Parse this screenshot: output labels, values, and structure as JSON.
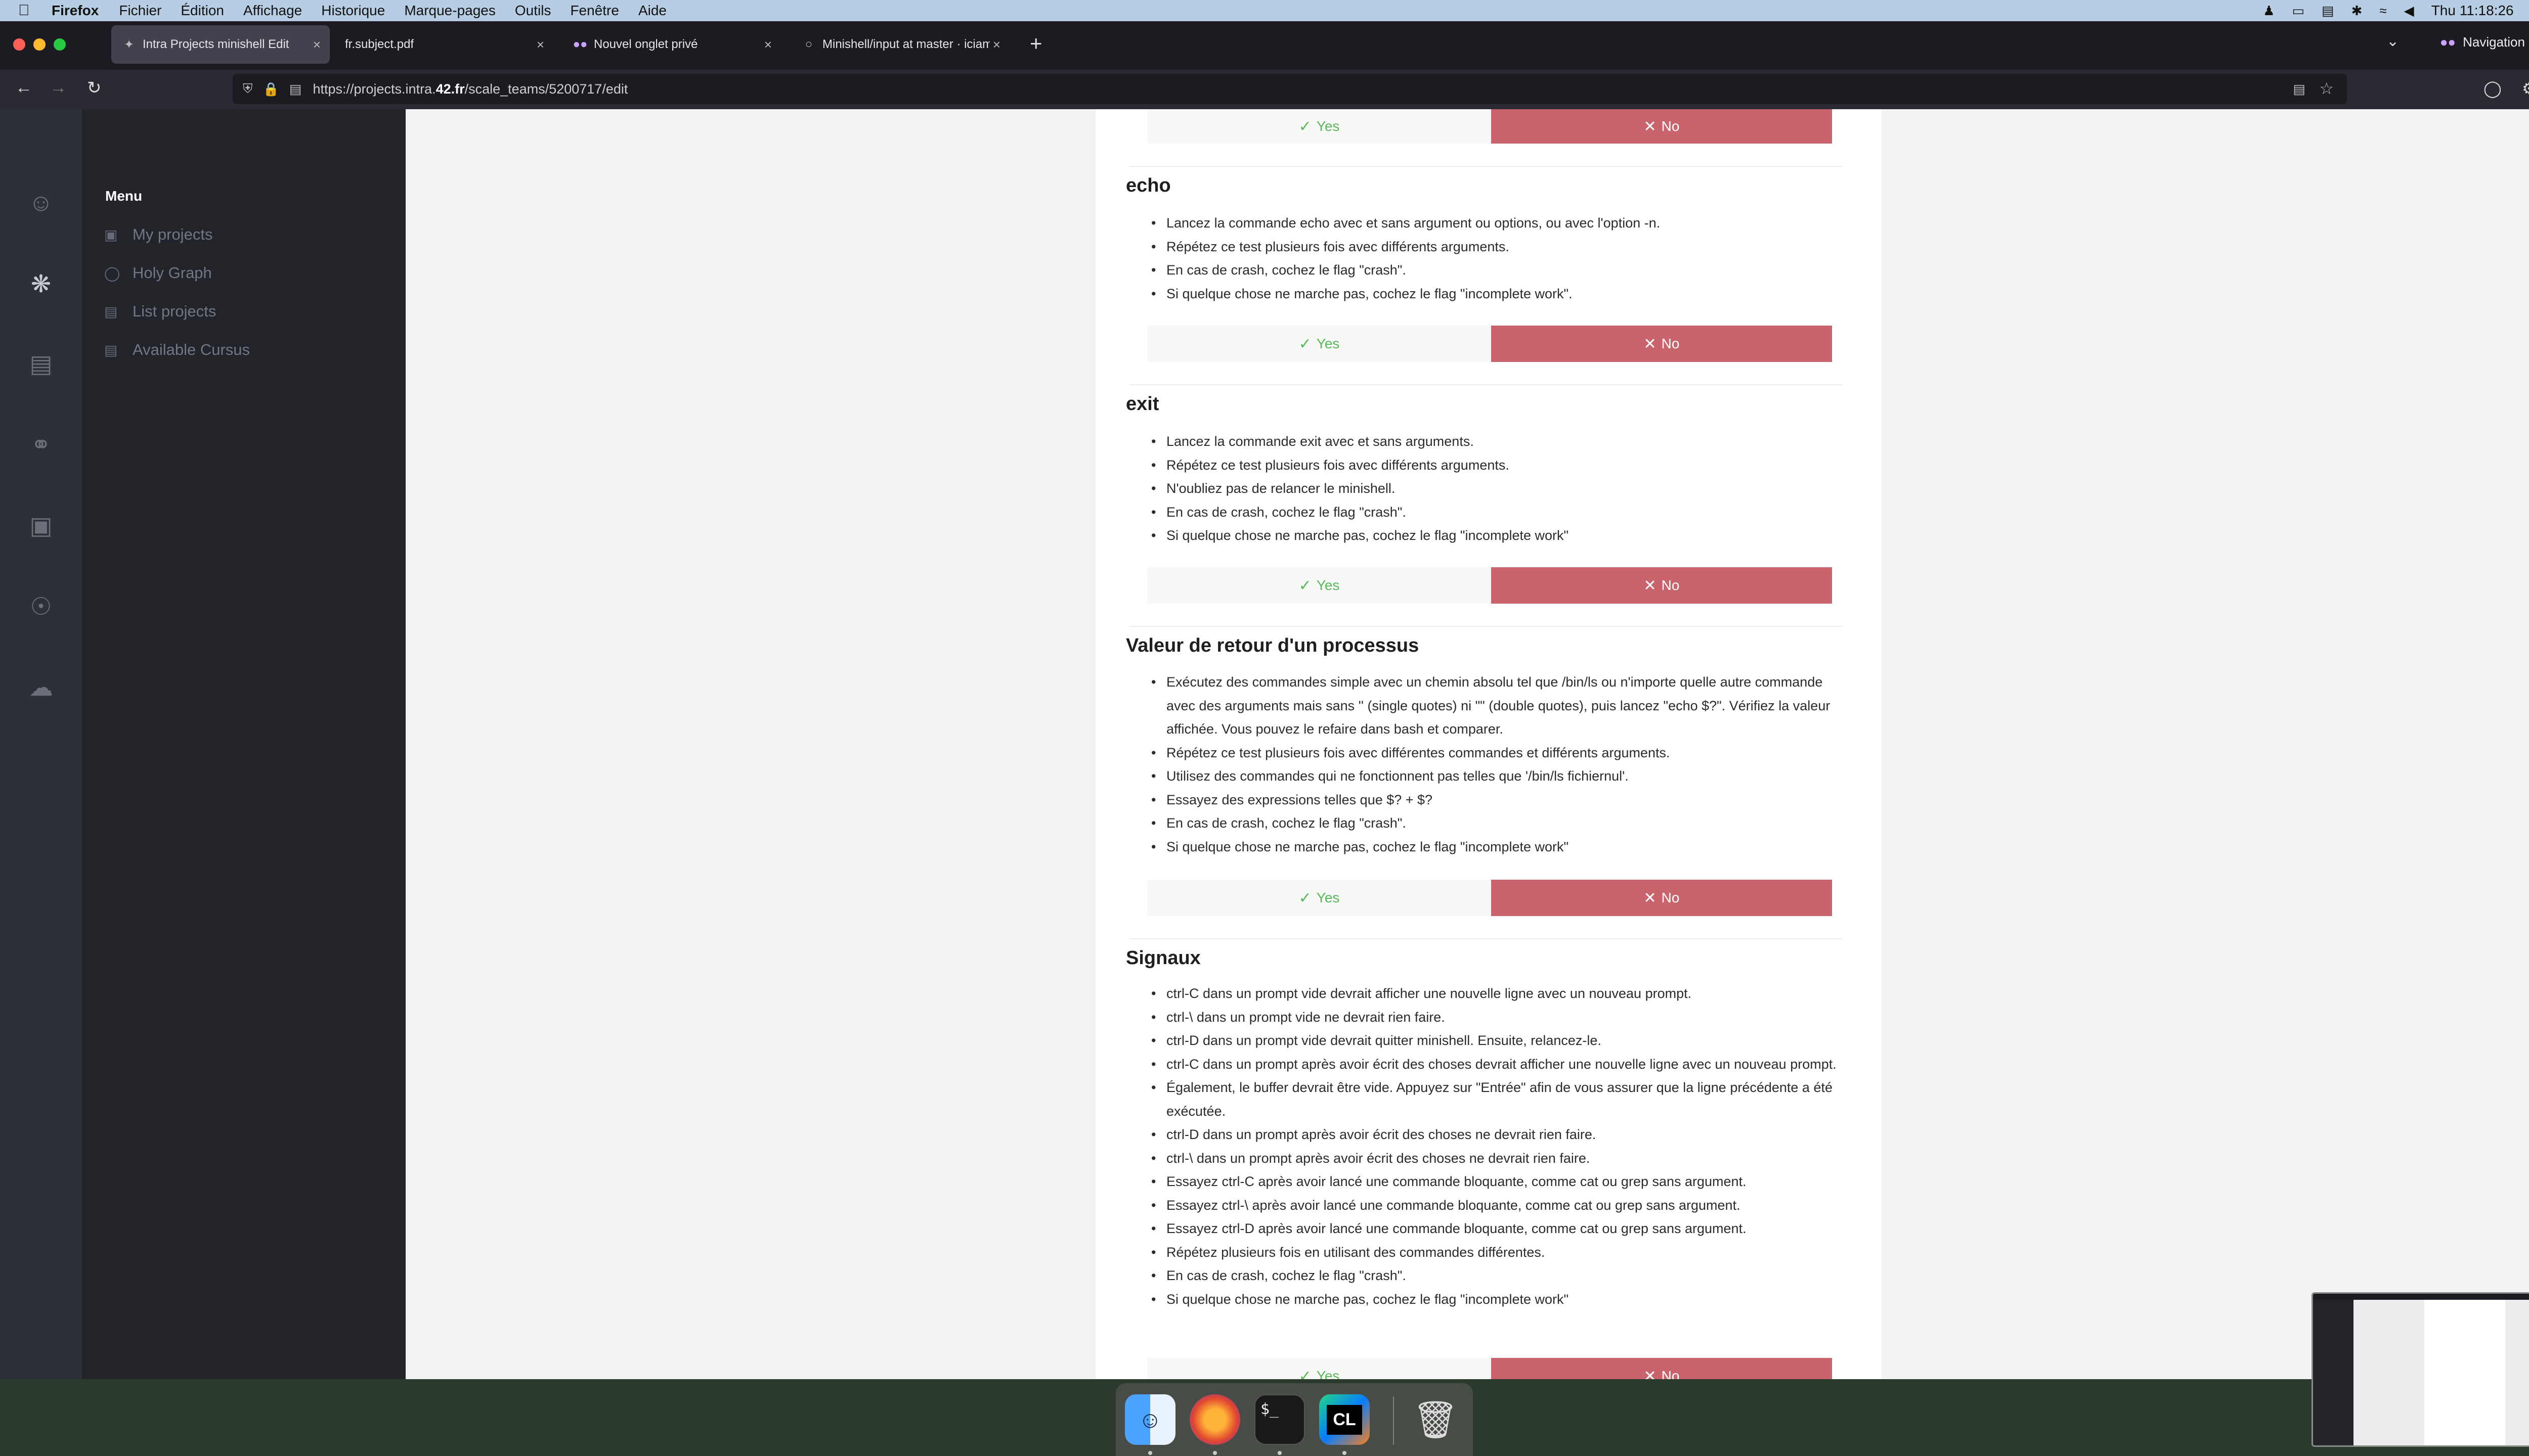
{
  "menubar": {
    "app": "Firefox",
    "items": [
      "Fichier",
      "Édition",
      "Affichage",
      "Historique",
      "Marque-pages",
      "Outils",
      "Fenêtre",
      "Aide"
    ],
    "clock": "Thu 11:18:26"
  },
  "tabs": [
    {
      "title": "Intra Projects minishell Edit",
      "active": true
    },
    {
      "title": "fr.subject.pdf",
      "active": false
    },
    {
      "title": "Nouvel onglet privé",
      "active": false
    },
    {
      "title": "Minishell/input at master · iciam",
      "active": false
    }
  ],
  "private_label": "Navigation privée",
  "url": {
    "prefix": "https://projects.intra.",
    "domain": "42.fr",
    "path": "/scale_teams/5200717/edit"
  },
  "sidebar_icons": [
    "user-icon",
    "holygraph-icon",
    "projects-icon",
    "chat-icon",
    "briefcase-icon",
    "compass-icon",
    "cart-icon"
  ],
  "menu": {
    "title": "Menu",
    "items": [
      {
        "label": "My projects",
        "icon": "folder-icon"
      },
      {
        "label": "Holy Graph",
        "icon": "graph-icon"
      },
      {
        "label": "List projects",
        "icon": "list-icon"
      },
      {
        "label": "Available Cursus",
        "icon": "cursus-icon"
      }
    ]
  },
  "buttons": {
    "yes": "Yes",
    "no": "No"
  },
  "sections": [
    {
      "title": "echo",
      "bullets": [
        "Lancez la commande echo avec et sans argument ou options, ou avec l'option -n.",
        "Répétez ce test plusieurs fois avec différents arguments.",
        "En cas de crash, cochez le flag \"crash\".",
        "Si quelque chose ne marche pas, cochez le flag \"incomplete work\"."
      ]
    },
    {
      "title": "exit",
      "bullets": [
        "Lancez la commande exit avec et sans arguments.",
        "Répétez ce test plusieurs fois avec différents arguments.",
        "N'oubliez pas de relancer le minishell.",
        "En cas de crash, cochez le flag \"crash\".",
        "Si quelque chose ne marche pas, cochez le flag \"incomplete work\""
      ]
    },
    {
      "title": "Valeur de retour d'un processus",
      "bullets": [
        "Exécutez des commandes simple avec un chemin absolu tel que /bin/ls ou n'importe quelle autre commande avec des arguments mais sans '' (single quotes) ni \"\" (double quotes), puis lancez \"echo $?\". Vérifiez la valeur affichée. Vous pouvez le refaire dans bash et comparer.",
        "Répétez ce test plusieurs fois avec différentes commandes et différents arguments.",
        "Utilisez des commandes qui ne fonctionnent pas telles que '/bin/ls fichiernul'.",
        "Essayez des expressions telles que $? + $?",
        "En cas de crash, cochez le flag \"crash\".",
        "Si quelque chose ne marche pas, cochez le flag \"incomplete work\""
      ]
    },
    {
      "title": "Signaux",
      "bullets": [
        "ctrl-C dans un prompt vide devrait afficher une nouvelle ligne avec un nouveau prompt.",
        "ctrl-\\ dans un prompt vide ne devrait rien faire.",
        "ctrl-D dans un prompt vide devrait quitter minishell. Ensuite, relancez-le.",
        "ctrl-C dans un prompt après avoir écrit des choses devrait afficher une nouvelle ligne avec un nouveau prompt.",
        "Également, le buffer devrait être vide. Appuyez sur \"Entrée\" afin de vous assurer que la ligne précédente a été exécutée.",
        "ctrl-D dans un prompt après avoir écrit des choses ne devrait rien faire.",
        "ctrl-\\ dans un prompt après avoir écrit des choses ne devrait rien faire.",
        "Essayez ctrl-C après avoir lancé une commande bloquante, comme cat ou grep sans argument.",
        "Essayez ctrl-\\ après avoir lancé une commande bloquante, comme cat ou grep sans argument.",
        "Essayez ctrl-D après avoir lancé une commande bloquante, comme cat ou grep sans argument.",
        "Répétez plusieurs fois en utilisant des commandes différentes.",
        "En cas de crash, cochez le flag \"crash\".",
        "Si quelque chose ne marche pas, cochez le flag \"incomplete work\""
      ]
    }
  ],
  "dock": [
    {
      "name": "Finder",
      "icon": "finder-icon"
    },
    {
      "name": "Firefox",
      "icon": "firefox-icon"
    },
    {
      "name": "Terminal",
      "icon": "terminal-icon",
      "glyph": "$_"
    },
    {
      "name": "CLion",
      "icon": "clion-icon",
      "glyph": "CL"
    },
    {
      "name": "Trash",
      "icon": "trash-icon"
    }
  ],
  "colors": {
    "yes_text": "#5cb85c",
    "no_bg": "#c9646c",
    "menu_panel": "#22242a",
    "icon_bar": "#2e3038",
    "browser_chrome": "#1c1b22"
  }
}
